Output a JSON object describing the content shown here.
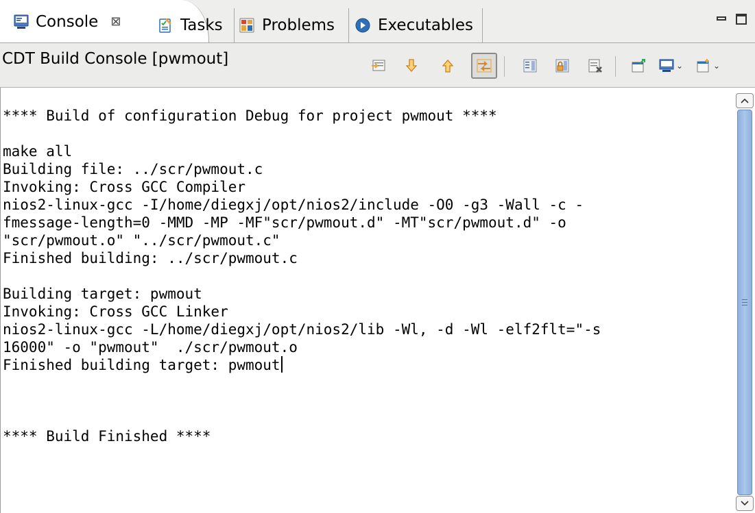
{
  "tabs": [
    {
      "label": "Console",
      "close": "⊠"
    },
    {
      "label": "Tasks"
    },
    {
      "label": "Problems"
    },
    {
      "label": "Executables"
    }
  ],
  "console": {
    "name": "CDT Build Console [pwmout]",
    "lines": [
      "**** Build of configuration Debug for project pwmout ****",
      "",
      "make all",
      "Building file: ../scr/pwmout.c",
      "Invoking: Cross GCC Compiler",
      "nios2-linux-gcc -I/home/diegxj/opt/nios2/include -O0 -g3 -Wall -c -",
      "fmessage-length=0 -MMD -MP -MF\"scr/pwmout.d\" -MT\"scr/pwmout.d\" -o",
      "\"scr/pwmout.o\" \"../scr/pwmout.c\"",
      "Finished building: ../scr/pwmout.c",
      "",
      "Building target: pwmout",
      "Invoking: Cross GCC Linker",
      "nios2-linux-gcc -L/home/diegxj/opt/nios2/lib -Wl, -d -Wl -elf2flt=\"-s",
      "16000\" -o \"pwmout\"  ./scr/pwmout.o",
      "Finished building target: pwmout",
      "",
      "",
      "",
      "**** Build Finished ****"
    ]
  },
  "toolbar": {
    "icons": [
      "open-console-icon",
      "next-icon",
      "previous-icon",
      "link-with-editor-icon",
      "scroll-lock-icon",
      "lock-icon",
      "clear-console-icon",
      "pin-console-icon",
      "display-console-icon",
      "new-console-icon"
    ]
  },
  "colors": {
    "tab_bg": "#eeeeec",
    "active_tab": "#ffffff",
    "scroll_thumb": "#a9c6ea",
    "icon_orange": "#e8a33a",
    "icon_green": "#3aa655",
    "icon_blue": "#2f6fb8"
  }
}
